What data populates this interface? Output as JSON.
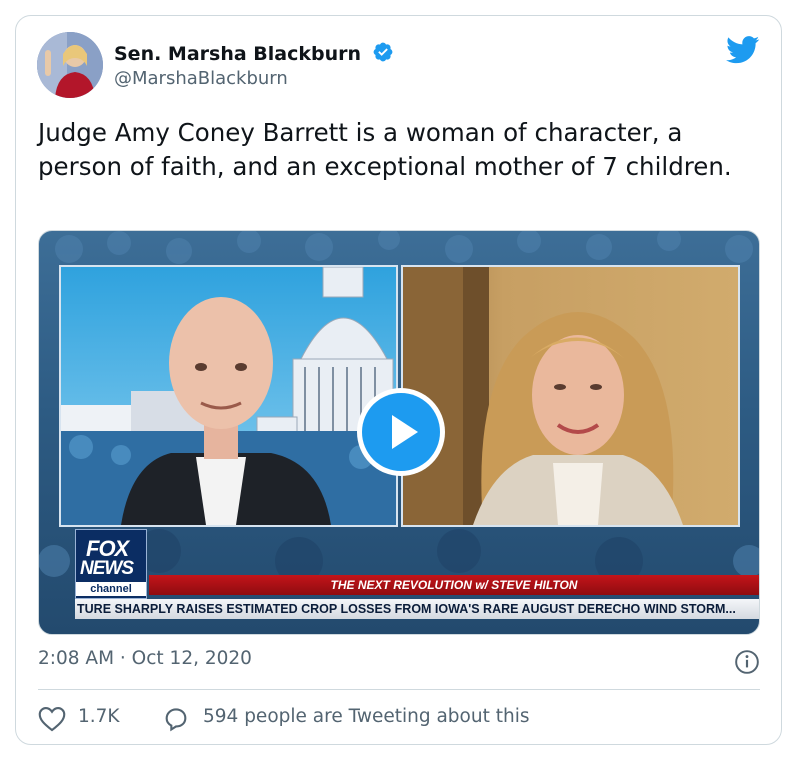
{
  "tweet": {
    "author_name": "Sen. Marsha Blackburn",
    "handle": "@MarshaBlackburn",
    "text": "Judge Amy Coney Barrett is a woman of character, a person of faith, and an exceptional mother of 7 children.",
    "timestamp": "2:08 AM · Oct 12, 2020",
    "likes": "1.7K",
    "tweeting_about": "594 people are Tweeting about this"
  },
  "video": {
    "network_logo_lines": [
      "FOX",
      "NEWS",
      "channel"
    ],
    "show_title": "THE NEXT REVOLUTION w/ STEVE HILTON",
    "ticker": "TURE SHARPLY RAISES ESTIMATED CROP LOSSES FROM IOWA'S RARE AUGUST DERECHO WIND STORM..."
  },
  "icons": {
    "verified": "verified-badge-icon",
    "platform": "twitter-bird-icon",
    "play": "play-icon",
    "info": "info-icon",
    "like": "heart-icon",
    "reply": "reply-bubble-icon"
  },
  "colors": {
    "accent": "#1d9bf0",
    "text": "#0f1419",
    "secondary_text": "#536471",
    "border": "#cfd9de"
  }
}
